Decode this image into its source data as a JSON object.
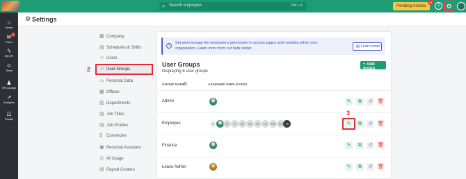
{
  "colors": {
    "brand": "#1e9c73",
    "accent": "#4a5bd4",
    "highlight": "#e02a36",
    "danger": "#e53935",
    "sidebar": "#2c2f33"
  },
  "topbar": {
    "search_placeholder": "Search employee",
    "search_shortcut": "Ctrl + K",
    "pending_label": "Pending Actions",
    "pending_badge": "15",
    "icons": [
      "logo",
      "search-icon",
      "help-icon",
      "gear-icon",
      "avatar"
    ]
  },
  "annotations": {
    "step1": "1",
    "step2": "2",
    "step3": "3"
  },
  "leftnav": {
    "items": [
      {
        "label": "Home",
        "icon": "home-icon"
      },
      {
        "label": "Feed",
        "icon": "megaphone-icon",
        "badge": "1"
      },
      {
        "label": "My HR",
        "icon": "bolt-icon"
      },
      {
        "label": "Team",
        "icon": "team-icon"
      },
      {
        "label": "HR Lounge",
        "icon": "lounge-icon"
      },
      {
        "label": "Analytics",
        "icon": "analytics-icon"
      },
      {
        "label": "People",
        "icon": "people-icon"
      }
    ]
  },
  "page": {
    "title": "Settings"
  },
  "settings_menu": {
    "items": [
      {
        "label": "Company",
        "icon": "building-icon"
      },
      {
        "label": "Schedules & Shifts",
        "icon": "calendar-icon"
      },
      {
        "label": "Users",
        "icon": "users-icon"
      },
      {
        "label": "User Groups",
        "icon": "user-groups-icon",
        "active": true
      },
      {
        "label": "Personal Data",
        "icon": "id-card-icon"
      },
      {
        "label": "Offices",
        "icon": "office-icon"
      },
      {
        "label": "Departments",
        "icon": "departments-icon"
      },
      {
        "label": "Job Titles",
        "icon": "job-title-icon"
      },
      {
        "label": "Job Grades",
        "icon": "job-grade-icon"
      },
      {
        "label": "Currencies",
        "icon": "currency-icon"
      },
      {
        "label": "Personal Assistant",
        "icon": "assistant-icon"
      },
      {
        "label": "AI Usage",
        "icon": "ai-icon"
      },
      {
        "label": "Payroll Centers",
        "icon": "payroll-icon"
      }
    ]
  },
  "main": {
    "info_text": "Set and manage the employee's permission to access pages and modules within your organization. Learn more from our help center.",
    "learn_more": "Learn more",
    "title": "User Groups",
    "subtitle": "Displaying 8 user groups",
    "add_group": "+ Add group",
    "columns": [
      "GROUP NAME",
      "ASSIGNED EMPLOYEES"
    ],
    "rows": [
      {
        "name": "Admin"
      },
      {
        "name": "Employee",
        "initials": [
          "JK",
          "C",
          "EV",
          "CV",
          "SL",
          "LS",
          "FM",
          "CH"
        ],
        "more": "+5"
      },
      {
        "name": "Finance"
      },
      {
        "name": "Leave Admin"
      }
    ]
  }
}
